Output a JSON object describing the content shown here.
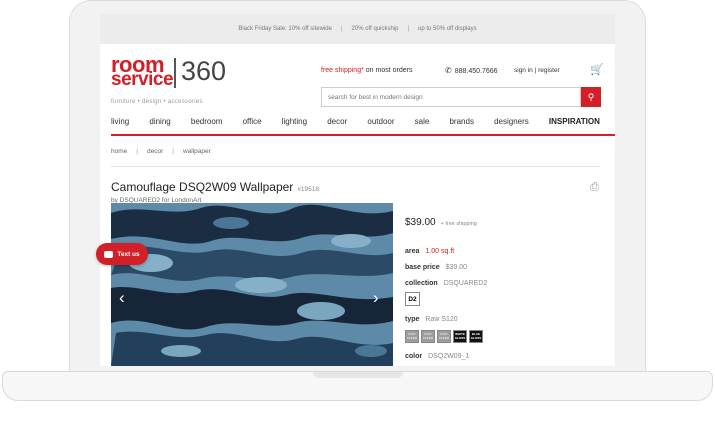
{
  "promo": [
    "Black Friday Sale: 10% off sitewide",
    "20% off quickship",
    "up to 50% off displays"
  ],
  "logo": {
    "room": "room",
    "service": "service",
    "number": "360",
    "tagline": "furniture  •  design  •  accessories"
  },
  "header": {
    "free_shipping": "free shipping*",
    "free_shipping_rest": " on most orders",
    "phone": "888.450.7666",
    "signin": "sign in | register",
    "search_placeholder": "search for best in modern design"
  },
  "nav": [
    "living",
    "dining",
    "bedroom",
    "office",
    "lighting",
    "decor",
    "outdoor",
    "sale",
    "brands",
    "designers",
    "INSPIRATION"
  ],
  "breadcrumb": [
    "home",
    "decor",
    "wallpaper"
  ],
  "product": {
    "title": "Camouflage DSQ2W09 Wallpaper",
    "sku": "#19518",
    "byline": "by DSQUARED2 for LondonArt",
    "price": "$39.00",
    "shipping_note": "+ free shipping",
    "area_label": "area",
    "area_value": "1.00 sq.ft",
    "base_price_label": "base price",
    "base_price_value": "$39.00",
    "collection_label": "collection",
    "collection_value": "DSQUARED2",
    "collection_badge": "D2",
    "type_label": "type",
    "type_value": "Raw S120",
    "type_swatches": [
      "FAST PAPER",
      "FAST PAPER",
      "FAST PAPER",
      "WHITE GLOSS",
      "BLUE GLOSS"
    ],
    "color_label": "color",
    "color_value": "DSQ2W09_1",
    "color_swatches": [
      "#3f5b77",
      "#b02a35",
      "#2c4f6b"
    ]
  },
  "text_us": "Text us",
  "colors": {
    "accent": "#d31f28",
    "camo_dark": "#16283b",
    "camo_mid": "#3d6d8f",
    "camo_light": "#7aa5be"
  }
}
